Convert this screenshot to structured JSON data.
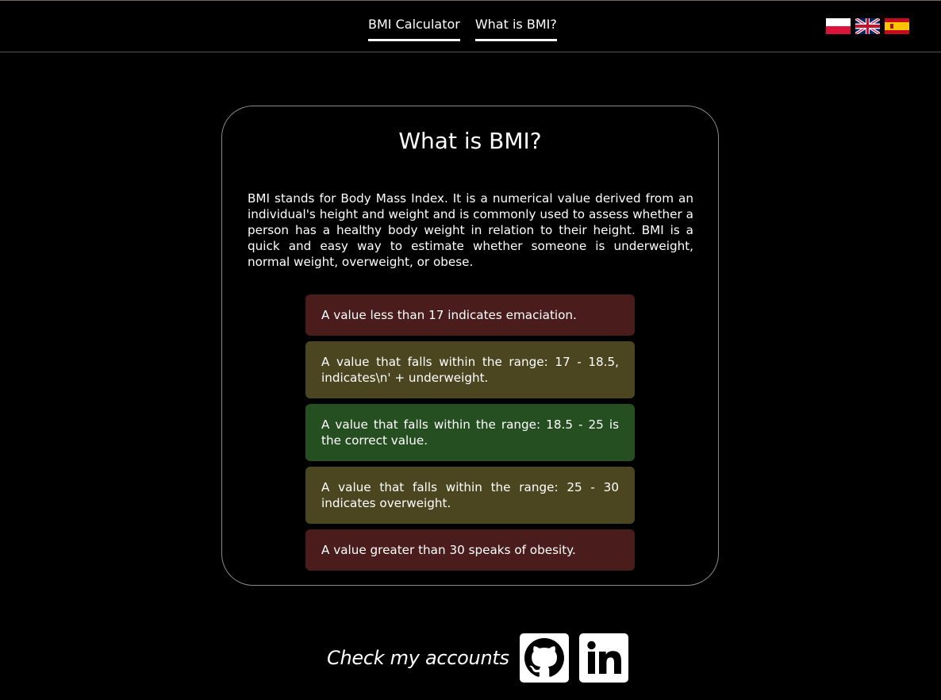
{
  "nav": {
    "items": [
      {
        "label": "BMI Calculator"
      },
      {
        "label": "What is BMI?"
      }
    ]
  },
  "languages": [
    {
      "icon": "poland-flag-icon"
    },
    {
      "icon": "uk-flag-icon"
    },
    {
      "icon": "spain-flag-icon"
    }
  ],
  "main": {
    "title": "What is BMI?",
    "description": "BMI stands for Body Mass Index. It is a numerical value derived from an individual's height and weight and is commonly used to assess whether a person has a healthy body weight in relation to their height. BMI is a quick and easy way to estimate whether someone is underweight, normal weight, overweight, or obese.",
    "ranges": [
      {
        "text": "A value less than 17 indicates emaciation.",
        "color": "#4a1c1c"
      },
      {
        "text": "A value that falls within the range: 17 - 18.5, indicates\\n' + underweight.",
        "color": "#4b4520"
      },
      {
        "text": "A value that falls within the range: 18.5 - 25 is the correct value.",
        "color": "#264f21"
      },
      {
        "text": "A value that falls within the range: 25 - 30 indicates overweight.",
        "color": "#4b4520"
      },
      {
        "text": "A value greater than 30 speaks of obesity.",
        "color": "#4a1c1c"
      }
    ]
  },
  "footer": {
    "label": "Check my accounts",
    "links": [
      {
        "icon": "github-icon"
      },
      {
        "icon": "linkedin-icon"
      }
    ]
  }
}
